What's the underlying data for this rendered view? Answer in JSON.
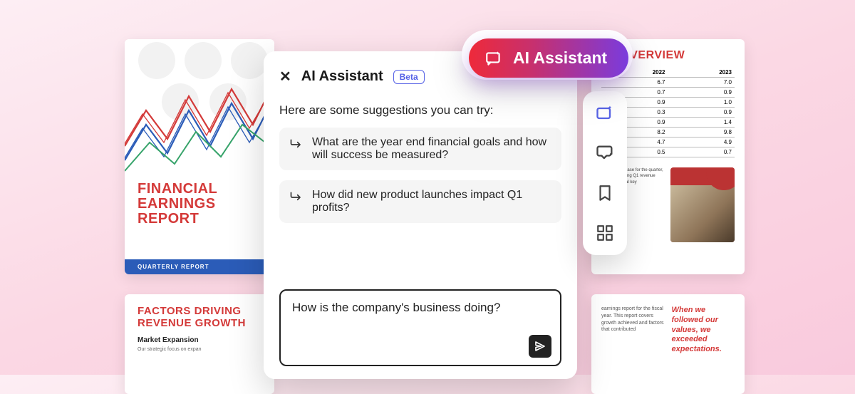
{
  "panel": {
    "title": "AI Assistant",
    "badge": "Beta",
    "intro": "Here are some suggestions you can try:",
    "suggestions": [
      "What are the year end financial goals and how will success be measured?",
      "How did new product launches impact Q1 profits?"
    ],
    "input_value": "How is the company's business doing?"
  },
  "pill_label": "AI Assistant",
  "docs": {
    "left": {
      "title_line1": "FINANCIAL",
      "title_line2": "EARNINGS",
      "title_line3": "REPORT",
      "subtitle": "QUARTERLY REPORT"
    },
    "right": {
      "title": "TH OVERVIEW",
      "table": {
        "headers": [
          "2022",
          "2023"
        ],
        "rows": [
          [
            "6.7",
            "7.0"
          ],
          [
            "0.7",
            "0.9"
          ],
          [
            "0.9",
            "1.0"
          ],
          [
            "0.3",
            "0.9"
          ],
          [
            "0.9",
            "1.4"
          ],
          [
            "8.2",
            "9.8"
          ],
          [
            "4.7",
            "4.9"
          ],
          [
            "0.5",
            "0.7"
          ]
        ]
      },
      "para": "revenue increase for the quarter, reflecting strong Q1 revenue across several key"
    },
    "bl": {
      "title_line1": "FACTORS DRIVING",
      "title_line2": "REVENUE GROWTH",
      "sub": "Market Expansion",
      "body": "Our strategic focus on expan"
    },
    "br": {
      "para": "earnings report for the fiscal year. This report covers growth achieved and factors that contributed",
      "quote": "When we followed our values, we exceeded expectations."
    }
  }
}
